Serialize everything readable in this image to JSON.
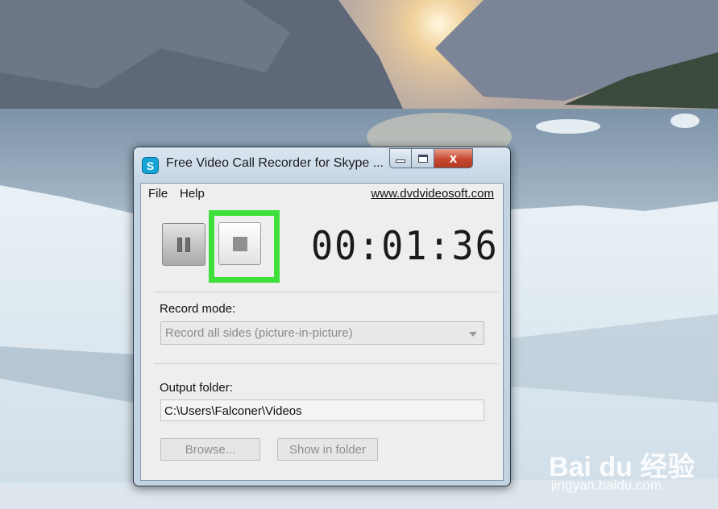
{
  "window": {
    "title": "Free Video Call Recorder for Skype ...",
    "close_glyph": "x"
  },
  "menu": {
    "file": "File",
    "help": "Help",
    "website": "www.dvdvideosoft.com"
  },
  "recorder": {
    "timer": "00:01:36"
  },
  "record_mode": {
    "label": "Record mode:",
    "selected": "Record all sides (picture-in-picture)"
  },
  "output": {
    "label": "Output folder:",
    "path": "C:\\Users\\Falconer\\Videos",
    "browse_label": "Browse...",
    "show_label": "Show in folder"
  },
  "watermark": {
    "brand": "Bai du 经验",
    "url": "jingyan.baidu.com"
  },
  "colors": {
    "highlight": "#3fe03a",
    "close_button": "#c7482f"
  }
}
